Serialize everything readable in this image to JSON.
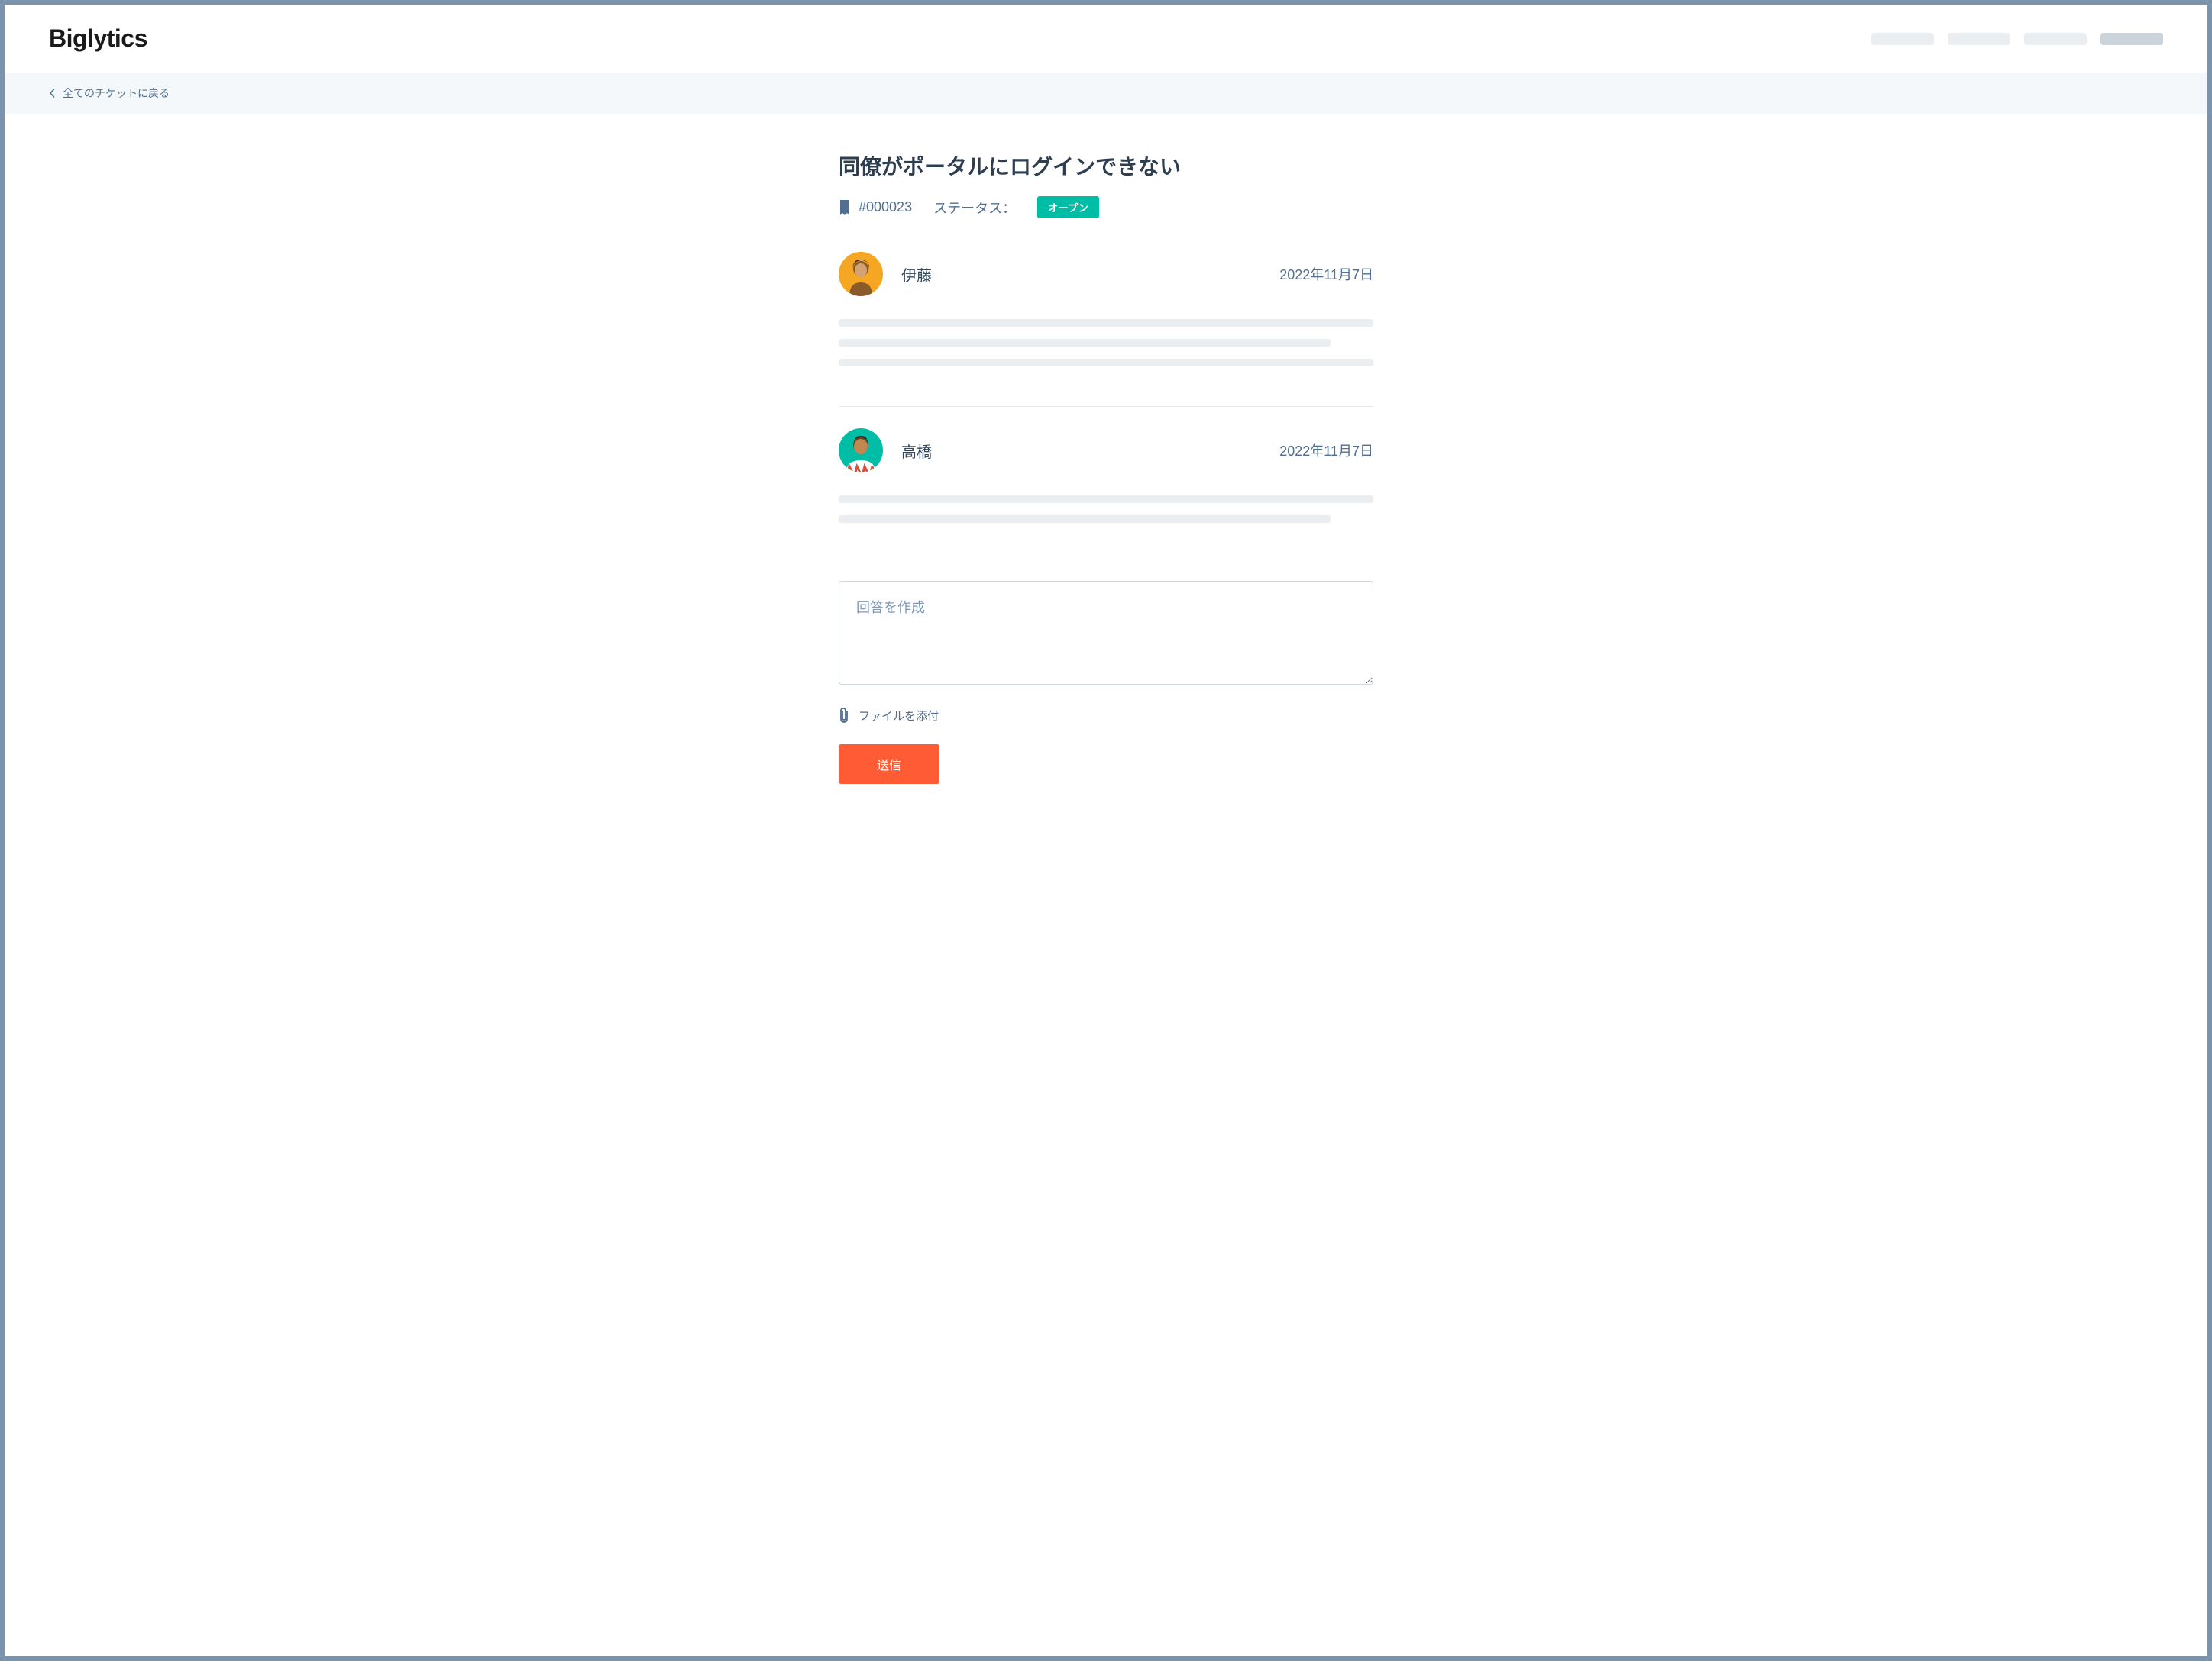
{
  "header": {
    "logo": "Biglytics"
  },
  "breadcrumb": {
    "back_label": "全てのチケットに戻る"
  },
  "ticket": {
    "title": "同僚がポータルにログインできない",
    "id": "#000023",
    "status_label": "ステータス：",
    "status_value": "オープン"
  },
  "messages": [
    {
      "author": "伊藤",
      "date": "2022年11月7日",
      "avatar_bg": "#f5a623",
      "lines": [
        100,
        92,
        100
      ]
    },
    {
      "author": "高橋",
      "date": "2022年11月7日",
      "avatar_bg": "#00bda5",
      "lines": [
        100,
        92
      ]
    }
  ],
  "reply": {
    "placeholder": "回答を作成",
    "attach_label": "ファイルを添付",
    "submit_label": "送信"
  }
}
